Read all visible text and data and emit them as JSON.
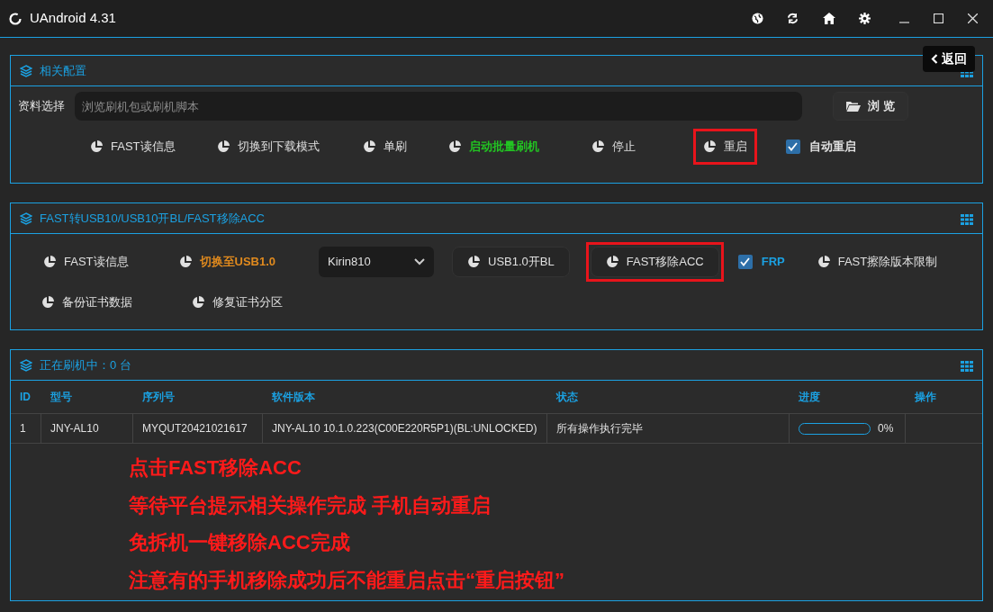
{
  "window": {
    "title": "UAndroid 4.31"
  },
  "back_button": {
    "label": "返回"
  },
  "config_panel": {
    "title": "相关配置",
    "file_label": "资料选择",
    "file_field": {
      "placeholder": "浏览刷机包或刷机脚本"
    },
    "browse_button": "浏 览",
    "actions": [
      {
        "kind": "button",
        "label": "FAST读信息",
        "color": "#e0e0e0",
        "marked": false
      },
      {
        "kind": "button",
        "label": "切换到下载模式",
        "color": "#e0e0e0",
        "marked": false
      },
      {
        "kind": "button",
        "label": "单刷",
        "color": "#e0e0e0",
        "marked": false
      },
      {
        "kind": "button",
        "label": "启动批量刷机",
        "color": "#22c422",
        "marked": false
      },
      {
        "kind": "button",
        "label": "停止",
        "color": "#e0e0e0",
        "marked": false
      },
      {
        "kind": "button",
        "label": "重启",
        "color": "#e0e0e0",
        "marked": true
      },
      {
        "kind": "checkbox",
        "label": "自动重启",
        "checked": true,
        "color": "#e0e0e0",
        "marked": false
      }
    ]
  },
  "fast_panel": {
    "title": "FAST转USB10/USB10开BL/FAST移除ACC",
    "rows": [
      [
        {
          "kind": "button",
          "label": "FAST读信息",
          "color": "#e0e0e0",
          "marked": false
        },
        {
          "kind": "button",
          "label": "切换至USB1.0",
          "color": "#e08a1e",
          "marked": false
        },
        {
          "kind": "select",
          "label": "Kirin810",
          "color": "#e0e0e0",
          "marked": false
        },
        {
          "kind": "boxed",
          "label": "USB1.0开BL",
          "color": "#e0e0e0",
          "marked": false
        },
        {
          "kind": "boxed",
          "label": "FAST移除ACC",
          "color": "#e0e0e0",
          "marked": true
        },
        {
          "kind": "checkbox",
          "label": "FRP",
          "checked": true,
          "color": "#1ba1e2",
          "marked": false
        },
        {
          "kind": "button",
          "label": "FAST擦除版本限制",
          "color": "#e0e0e0",
          "marked": false
        }
      ],
      [
        {
          "kind": "button",
          "label": "备份证书数据",
          "color": "#e0e0e0",
          "marked": false
        },
        {
          "kind": "button",
          "label": "修复证书分区",
          "color": "#e0e0e0",
          "marked": false
        }
      ]
    ]
  },
  "flash_panel": {
    "title": "正在刷机中：0 台",
    "table": {
      "columns": [
        "ID",
        "型号",
        "序列号",
        "软件版本",
        "状态",
        "进度",
        "操作"
      ],
      "rows": [
        {
          "id": "1",
          "model": "JNY-AL10",
          "serial": "MYQUT20421021617",
          "version": "JNY-AL10 10.1.0.223(C00E220R5P1)(BL:UNLOCKED)",
          "status": "所有操作执行完毕",
          "level": 0,
          "progress": "0%"
        }
      ]
    }
  },
  "annotations": [
    "点击FAST移除ACC",
    "等待平台提示相关操作完成 手机自动重启",
    "免拆机一键移除ACC完成",
    "注意有的手机移除成功后不能重启点击“重启按钮”"
  ]
}
